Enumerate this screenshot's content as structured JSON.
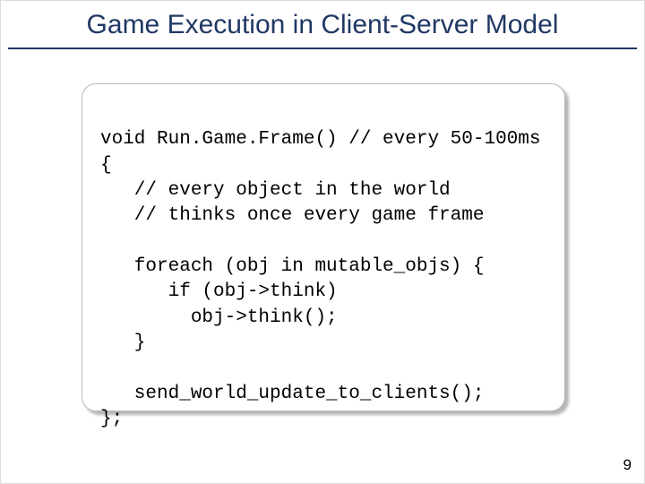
{
  "title": "Game Execution in Client-Server Model",
  "code": {
    "l1": "void Run.Game.Frame() // every 50-100ms",
    "l2": "{",
    "l3": "   // every object in the world",
    "l4": "   // thinks once every game frame",
    "l5": "",
    "l6": "   foreach (obj in mutable_objs) {",
    "l7": "      if (obj->think)",
    "l8": "        obj->think();",
    "l9": "   }",
    "l10": "",
    "l11": "   send_world_update_to_clients();",
    "l12": "};"
  },
  "page_number": "9"
}
